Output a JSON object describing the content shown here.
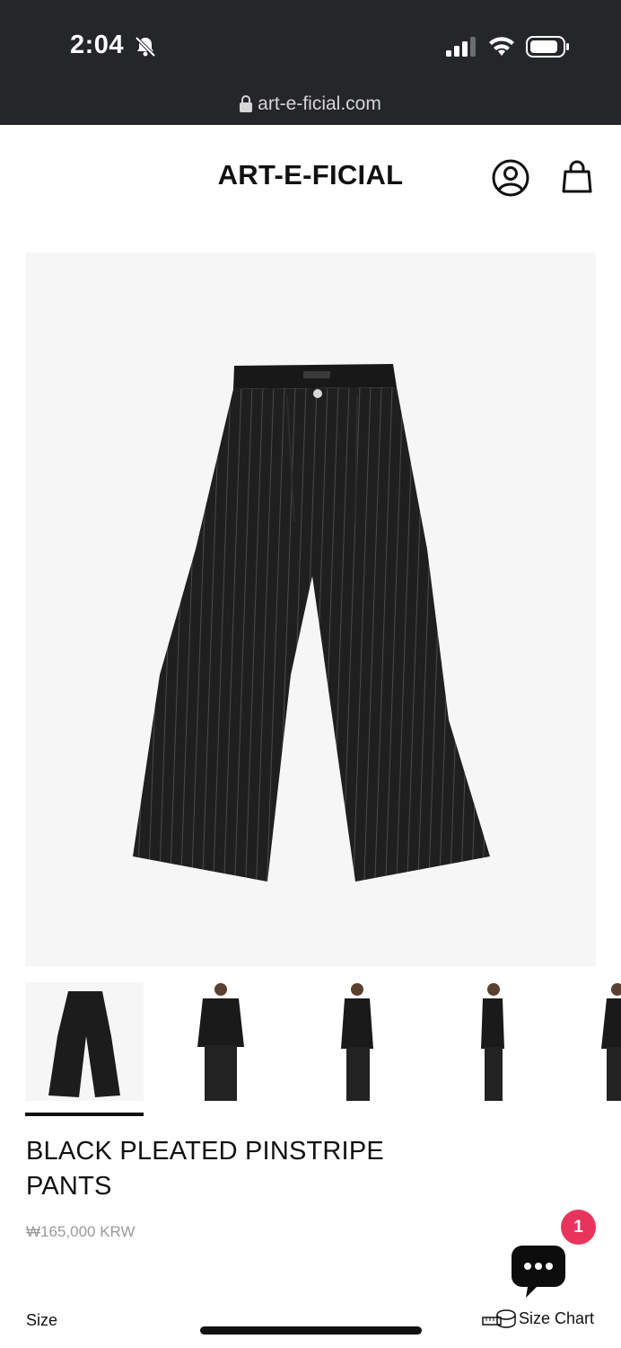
{
  "status_bar": {
    "time": "2:04",
    "url": "art-e-ficial.com"
  },
  "header": {
    "brand": "ART-E-FICIAL"
  },
  "product": {
    "title_line1": "BLACK PLEATED PINSTRIPE",
    "title_line2": "PANTS",
    "price": "₩165,000 KRW",
    "size_label": "Size",
    "size_chart_label": "Size Chart"
  },
  "chat": {
    "badge_count": "1"
  },
  "colors": {
    "status_bg": "#25262a",
    "badge": "#e8345c",
    "image_bg": "#f6f6f6"
  }
}
